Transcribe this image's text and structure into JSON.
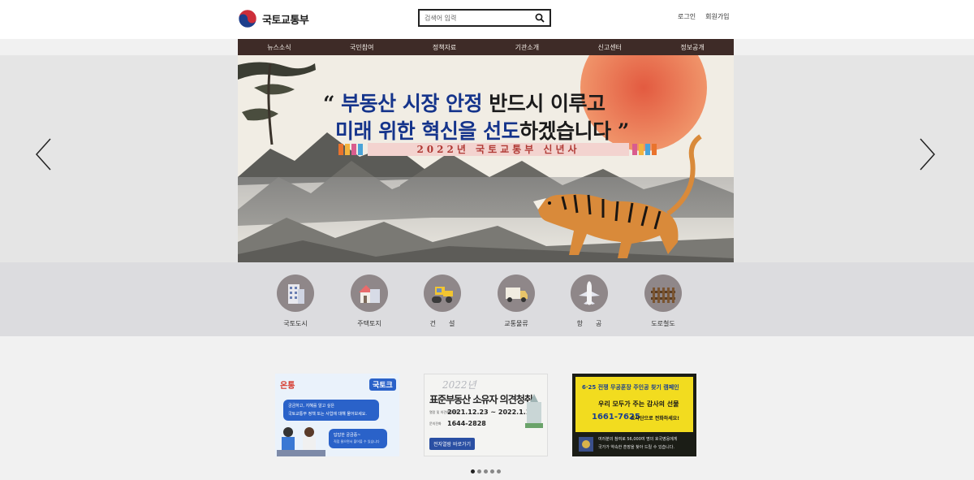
{
  "header": {
    "logo_text": "국토교통부",
    "search_placeholder": "검색어 입력",
    "login": "로그인",
    "signup": "회원가입"
  },
  "nav": {
    "items": [
      "뉴스소식",
      "국민참여",
      "정책자료",
      "기관소개",
      "신고센터",
      "정보공개"
    ]
  },
  "banner": {
    "quote_open": "“",
    "line1_a": "부동산 시장 안정",
    "line1_b": "반드시 이루고",
    "line2_a": "미래 위한 혁신을 선도",
    "line2_b": "하겠습니다",
    "quote_close": "”",
    "year_text": "2022년 국토교통부 신년사"
  },
  "categories": {
    "items": [
      {
        "label": "국토도시",
        "icon": "building-icon"
      },
      {
        "label": "주택토지",
        "icon": "house-icon"
      },
      {
        "label": "건　　설",
        "icon": "roller-icon"
      },
      {
        "label": "교통물류",
        "icon": "truck-icon"
      },
      {
        "label": "항　　공",
        "icon": "airplane-icon"
      },
      {
        "label": "도로철도",
        "icon": "railway-icon"
      }
    ]
  },
  "promos": {
    "p1": {
      "brand": "온통",
      "badge": "국토크",
      "text1": "궁금하고, 지혜를 알고 싶은",
      "text2": "국토교통부 정책 또는 사업에 대해 물어보세요.",
      "text3": "답답한 궁금증~",
      "text4": "직접 물으면서 풀어볼 수 있습니다"
    },
    "p2": {
      "year": "2022년",
      "title": "표준부동산 소유자 의견청취",
      "period": "2021.12.23 ~ 2022.1.10",
      "period_label": "열람 및 의견제출기간",
      "phone_label": "문의전화",
      "phone": "1644-2828",
      "button": "전자열람 바로가기"
    },
    "p3": {
      "top": "6·25 전쟁 무공훈장 주인공 찾기 캠페인",
      "line1": "우리 모두가 주는 감사의 선물",
      "phone": "1661-7625",
      "line2": "조사단으로 전화하세요!",
      "bottom1": "여러분의 참여로 56,000여 명의 호국영웅에게",
      "bottom2": "국가가 약속한 훈장을 찾아 드릴 수 있습니다."
    }
  },
  "carousel": {
    "dot_count": 5,
    "active_index": 0
  },
  "colors": {
    "nav_bg": "#3e2b27",
    "headline_blue": "#15348b",
    "category_circle": "#8f8789"
  }
}
